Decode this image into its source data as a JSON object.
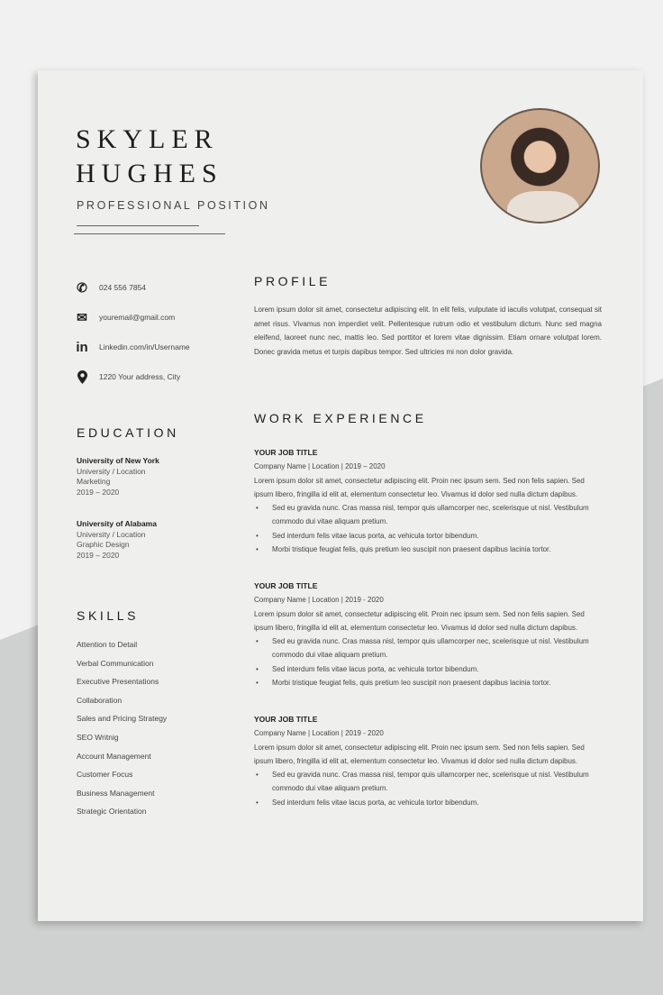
{
  "name": {
    "first": "SKYLER",
    "last": "HUGHES"
  },
  "position": "PROFESSIONAL POSITION",
  "contact": [
    {
      "icon": "phone-icon",
      "text": "024 556 7854"
    },
    {
      "icon": "email-icon",
      "text": "youremail@gmail.com"
    },
    {
      "icon": "linkedin-icon",
      "text": "Linkedin.com/in/Username"
    },
    {
      "icon": "location-pin-icon",
      "text": "1220 Your address, City"
    }
  ],
  "education": {
    "heading": "EDUCATION",
    "items": [
      {
        "school": "University of New York",
        "location": "University / Location",
        "field": "Marketing",
        "years": "2019 – 2020"
      },
      {
        "school": "University of Alabama",
        "location": "University / Location",
        "field": "Graphic Design",
        "years": "2019 – 2020"
      }
    ]
  },
  "skills": {
    "heading": "SKILLS",
    "items": [
      "Attention to Detail",
      "Verbal Communication",
      "Executive Presentations",
      "Collaboration",
      "Sales and Pricing Strategy",
      "SEO Writnig",
      "Account Management",
      "Customer Focus",
      "Business Management",
      "Strategic Orientation"
    ]
  },
  "profile": {
    "heading": "PROFILE",
    "text": "Lorem ipsum dolor sit amet, consectetur adipiscing elit. In elit felis, vulputate id iaculis volutpat, consequat sit amet risus. Vivamus non imperdiet velit. Pellentesque rutrum odio et vestibulum dictum. Nunc sed magna eleifend, laoreet nunc nec, mattis leo. Sed porttitor et lorem vitae dignissim. Etiam ornare volutpat lorem. Donec gravida metus et turpis dapibus tempor. Sed ultricies mi non dolor gravida."
  },
  "work": {
    "heading": "WORK EXPERIENCE",
    "jobs": [
      {
        "title": "YOUR JOB TITLE",
        "meta": "Company Name | Location | 2019 – 2020",
        "desc": "Lorem ipsum dolor sit amet, consectetur adipiscing elit. Proin nec ipsum sem. Sed non felis sapien. Sed ipsum libero, fringilla id elit at, elementum consectetur leo. Vivamus id dolor sed nulla dictum dapibus.",
        "bullets": [
          "Sed eu gravida nunc. Cras massa nisl, tempor quis ullamcorper nec, scelerisque ut nisl. Vestibulum commodo dui vitae aliquam pretium.",
          "Sed interdum felis vitae lacus porta, ac vehicula tortor bibendum.",
          "Morbi tristique feugiat felis, quis pretium leo suscipit non praesent dapibus lacinia tortor."
        ]
      },
      {
        "title": "YOUR JOB TITLE",
        "meta": "Company Name | Location | 2019 - 2020",
        "desc": "Lorem ipsum dolor sit amet, consectetur adipiscing elit. Proin nec ipsum sem. Sed non felis sapien. Sed ipsum libero, fringilla id elit at, elementum consectetur leo. Vivamus id dolor sed nulla dictum dapibus.",
        "bullets": [
          "Sed eu gravida nunc. Cras massa nisl, tempor quis ullamcorper nec, scelerisque ut nisl. Vestibulum commodo dui vitae aliquam pretium.",
          "Sed interdum felis vitae lacus porta, ac vehicula tortor bibendum.",
          "Morbi tristique feugiat felis, quis pretium leo suscipit non praesent dapibus lacinia tortor."
        ]
      },
      {
        "title": "YOUR JOB TITLE",
        "meta": "Company Name | Location | 2019 - 2020",
        "desc": "Lorem ipsum dolor sit amet, consectetur adipiscing elit. Proin nec ipsum sem. Sed non felis sapien. Sed ipsum libero, fringilla id elit at, elementum consectetur leo. Vivamus id dolor sed nulla dictum dapibus.",
        "bullets": [
          "Sed eu gravida nunc. Cras massa nisl, tempor quis ullamcorper nec, scelerisque ut nisl. Vestibulum commodo dui vitae aliquam pretium.",
          "Sed interdum felis vitae lacus porta, ac vehicula tortor bibendum."
        ]
      }
    ]
  }
}
